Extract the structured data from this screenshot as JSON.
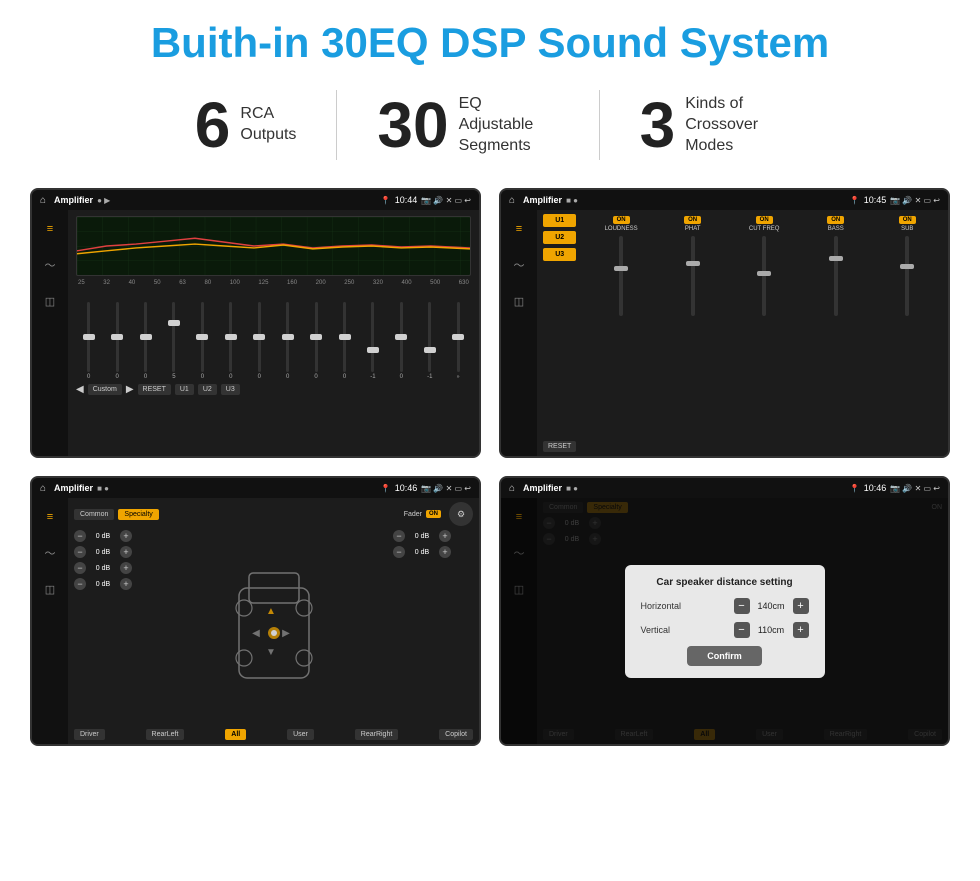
{
  "header": {
    "title": "Buith-in 30EQ DSP Sound System"
  },
  "stats": [
    {
      "number": "6",
      "label": "RCA\nOutputs"
    },
    {
      "number": "30",
      "label": "EQ Adjustable\nSegments"
    },
    {
      "number": "3",
      "label": "Kinds of\nCrossover Modes"
    }
  ],
  "screens": [
    {
      "id": "screen1",
      "time": "10:44",
      "app": "Amplifier",
      "type": "eq",
      "freqs": [
        "25",
        "32",
        "40",
        "50",
        "63",
        "80",
        "100",
        "125",
        "160",
        "200",
        "250",
        "320",
        "400",
        "500",
        "630"
      ],
      "values": [
        "0",
        "0",
        "0",
        "5",
        "0",
        "0",
        "0",
        "0",
        "0",
        "0",
        "0",
        "-1",
        "0",
        "-1"
      ],
      "preset": "Custom",
      "buttons": [
        "RESET",
        "U1",
        "U2",
        "U3"
      ]
    },
    {
      "id": "screen2",
      "time": "10:45",
      "app": "Amplifier",
      "type": "amplifier",
      "presets": [
        "U1",
        "U2",
        "U3"
      ],
      "channels": [
        {
          "name": "LOUDNESS",
          "on": true
        },
        {
          "name": "PHAT",
          "on": true
        },
        {
          "name": "CUT FREQ",
          "on": true
        },
        {
          "name": "BASS",
          "on": true
        },
        {
          "name": "SUB",
          "on": true
        }
      ],
      "reset_btn": "RESET"
    },
    {
      "id": "screen3",
      "time": "10:46",
      "app": "Amplifier",
      "type": "crossover",
      "tabs": [
        "Common",
        "Specialty"
      ],
      "active_tab": "Specialty",
      "fader_label": "Fader",
      "fader_on": true,
      "db_rows": [
        {
          "val": "0 dB"
        },
        {
          "val": "0 dB"
        },
        {
          "val": "0 dB"
        },
        {
          "val": "0 dB"
        }
      ],
      "right_db_rows": [
        {
          "val": "0 dB"
        },
        {
          "val": "0 dB"
        }
      ],
      "bottom_btns": [
        "Driver",
        "RearLeft",
        "All",
        "User",
        "RearRight",
        "Copilot"
      ]
    },
    {
      "id": "screen4",
      "time": "10:46",
      "app": "Amplifier",
      "type": "crossover_dialog",
      "tabs": [
        "Common",
        "Specialty"
      ],
      "dialog": {
        "title": "Car speaker distance setting",
        "horizontal_label": "Horizontal",
        "horizontal_val": "140cm",
        "vertical_label": "Vertical",
        "vertical_val": "110cm",
        "confirm_btn": "Confirm"
      },
      "bottom_btns": [
        "Driver",
        "RearLeft",
        "All",
        "User",
        "RearRight",
        "Copilot"
      ]
    }
  ]
}
